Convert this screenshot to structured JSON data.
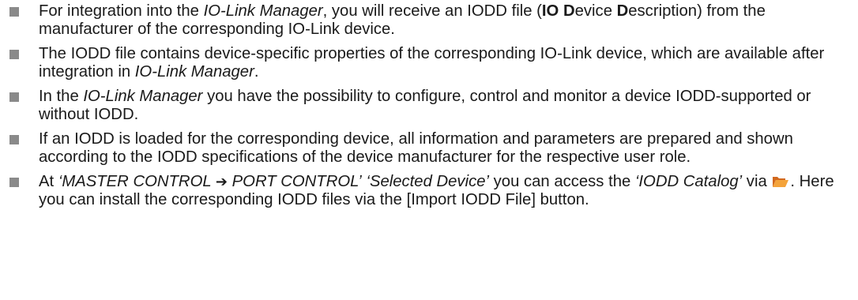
{
  "bullets": [
    {
      "parts": [
        "For integration into the ",
        "IO-Link Manager",
        ", you will receive an IODD file (",
        "IO",
        " ",
        "D",
        "evice ",
        "D",
        "escription) from the manufacturer of the corresponding IO-Link device."
      ]
    },
    {
      "parts": [
        "The IODD file contains device-specific properties of the corresponding IO-Link device, which are available after integration in ",
        "IO-Link Manager",
        "."
      ]
    },
    {
      "parts": [
        "In the ",
        "IO-Link Manager",
        " you have the possibility to configure, control and monitor a device IODD-supported or without IODD."
      ]
    },
    {
      "parts": [
        "If an IODD is loaded for the corresponding device, all information and parameters are prepared and shown according to the IODD specifications of the device manufacturer for the respective user role."
      ]
    },
    {
      "parts": [
        "At ",
        "‘MASTER CONTROL ",
        "➔",
        " PORT CONTROL’",
        "  ",
        "‘Selected Device’",
        " you can access the ",
        "‘IODD Catalog’",
        " via ",
        ". Here you can install the corresponding IODD files via the [Import IODD File] button."
      ]
    }
  ],
  "icons": {
    "folder": "folder-open-icon",
    "bullet": "square-bullet",
    "arrow": "right-arrow"
  },
  "colors": {
    "text": "#1a1a1a",
    "bullet": "#8a8a8a",
    "folder_back": "#d2691e",
    "folder_front": "#f4a33a"
  }
}
